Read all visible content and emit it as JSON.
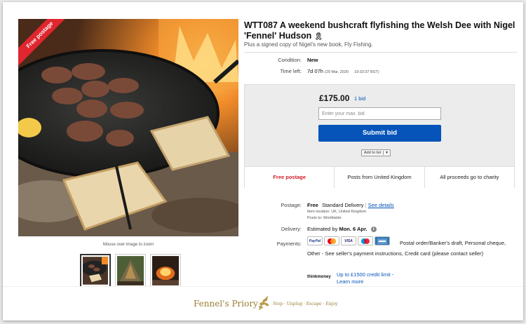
{
  "listing": {
    "ribbon": "Free postage",
    "title": "WTT087 A weekend bushcraft flyfishing the Welsh Dee with Nigel 'Fennel' Hudson",
    "subtitle": "Plus a signed copy of Nigel's new book, Fly Fishing.",
    "zoom_hint": "Mouse over image to zoom",
    "thumbnails": [
      "thumbnail-1",
      "thumbnail-2",
      "thumbnail-3"
    ]
  },
  "details": {
    "condition_label": "Condition:",
    "condition_value": "New",
    "time_label": "Time left:",
    "time_value": "7d 07h",
    "time_date": "(29 Mar, 2020",
    "time_clock": "19:33:37 BST)"
  },
  "bid": {
    "price": "£175.00",
    "bid_count": "1 bid",
    "input_placeholder": "Enter your max. bid",
    "submit_label": "Submit bid",
    "add_to_list": "Add to list",
    "features": [
      "Free postage",
      "Posts from United Kingdom",
      "All proceeds go to charity"
    ]
  },
  "shipping": {
    "postage_label": "Postage:",
    "postage_free": "Free",
    "postage_method": "Standard Delivery",
    "see_details": "See details",
    "item_location": "Item location: UK, United Kingdom",
    "posts_to": "Posts to: Worldwide",
    "delivery_label": "Delivery:",
    "delivery_prefix": "Estimated by",
    "delivery_date": "Mon. 6 Apr.",
    "payments_label": "Payments:",
    "payments_text": "Postal order/Banker's draft, Personal cheque, Other - See seller's payment instructions, Credit card (please contact seller)",
    "pay_logos": [
      "PayPal",
      "Mastercard",
      "VISA",
      "Maestro",
      "Amex"
    ],
    "thinkmoney": "thinkmoney",
    "credit_limit": "Up to £1500 credit limit -",
    "learn_more": "Learn more"
  },
  "footer": {
    "brand": "Fennel's Priory",
    "tagline": "Stop · Unplug · Escape · Enjoy"
  },
  "colors": {
    "accent_blue": "#0654ba",
    "ribbon_red": "#e0262f",
    "brand_gold": "#9a7d33"
  }
}
